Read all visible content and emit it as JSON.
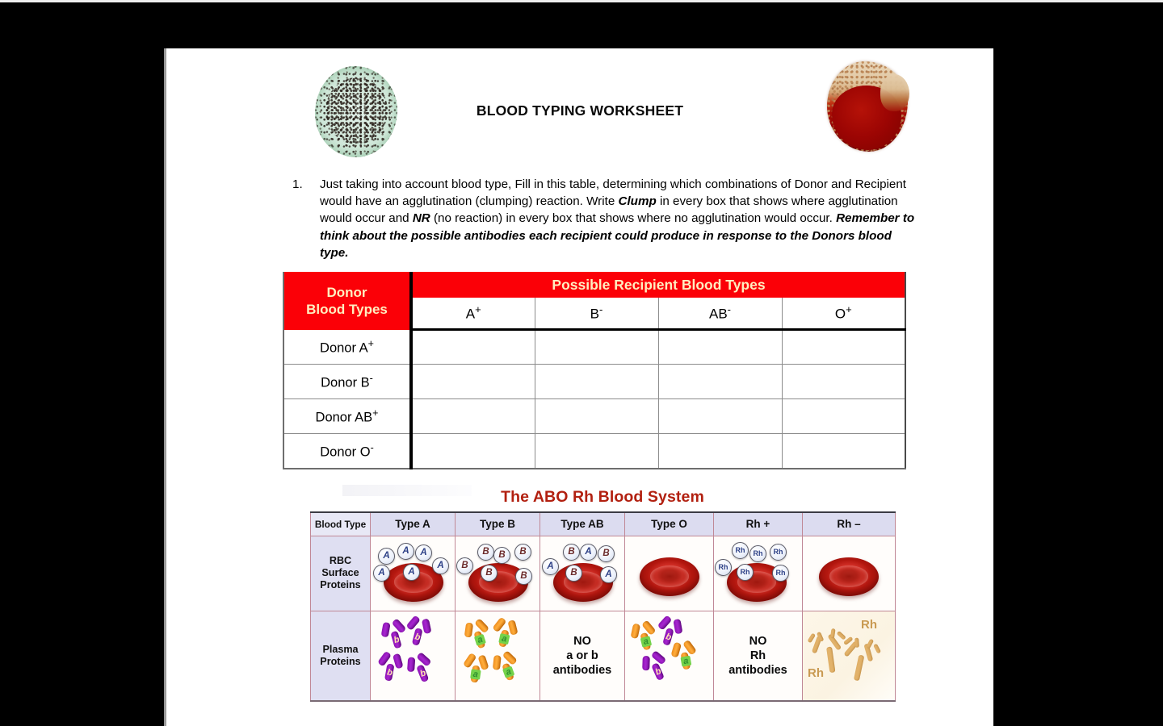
{
  "document": {
    "title": "BLOOD TYPING WORKSHEET",
    "left_image_name": "white-blood-cell-image",
    "right_image_name": "blood-sample-image"
  },
  "question": {
    "number": "1.",
    "part1": "Just taking into account blood type, Fill in this table, determining which combinations of Donor and Recipient would have an agglutination (clumping) reaction. Write ",
    "emph1": "Clump",
    "part2": " in every box that shows where agglutination would occur and ",
    "emph2": "NR",
    "part3": " (no reaction) in every box that shows where no agglutination would occur",
    "part4": ". ",
    "emph3": "Remember to think about the possible antibodies each recipient could produce in response to the Donors blood type."
  },
  "worksheet_table": {
    "donor_header_line1": "Donor",
    "donor_header_line2": "Blood Types",
    "recipient_header": "Possible Recipient Blood Types",
    "recipient_types": [
      {
        "letter": "A",
        "sign": "+"
      },
      {
        "letter": "B",
        "sign": "-"
      },
      {
        "letter": "AB",
        "sign": "-"
      },
      {
        "letter": "O",
        "sign": "+"
      }
    ],
    "donor_rows": [
      {
        "label": "Donor A",
        "sign": "+",
        "answers": [
          "",
          "",
          "",
          ""
        ]
      },
      {
        "label": "Donor B",
        "sign": "-",
        "answers": [
          "",
          "",
          "",
          ""
        ]
      },
      {
        "label": "Donor AB",
        "sign": "+",
        "answers": [
          "",
          "",
          "",
          ""
        ]
      },
      {
        "label": "Donor O",
        "sign": "-",
        "answers": [
          "",
          "",
          "",
          ""
        ]
      }
    ],
    "colors": {
      "header_bg": "#fb0007",
      "header_text": "#ffeec0",
      "grid": "#8c8c8c"
    }
  },
  "abo_figure": {
    "title": "The ABO Rh Blood System",
    "title_color": "#b22010",
    "corner_label": "Blood Type",
    "columns": [
      "Type A",
      "Type B",
      "Type AB",
      "Type O",
      "Rh +",
      "Rh –"
    ],
    "rows": [
      {
        "label": "RBC\nSurface\nProteins",
        "label_lines": [
          "RBC",
          "Surface",
          "Proteins"
        ],
        "cells": [
          {
            "kind": "rbc",
            "markers": [
              "A",
              "A",
              "A",
              "A",
              "A",
              "A"
            ]
          },
          {
            "kind": "rbc",
            "markers": [
              "B",
              "B",
              "B",
              "B",
              "B",
              "B"
            ]
          },
          {
            "kind": "rbc",
            "markers": [
              "B",
              "A",
              "B",
              "A",
              "B",
              "A"
            ]
          },
          {
            "kind": "rbc",
            "markers": []
          },
          {
            "kind": "rbc",
            "markers": [
              "Rh",
              "Rh",
              "Rh",
              "Rh",
              "Rh",
              "Rh"
            ]
          },
          {
            "kind": "rbc",
            "markers": []
          }
        ]
      },
      {
        "label_lines": [
          "Plasma",
          "Proteins"
        ],
        "cells": [
          {
            "kind": "antibody",
            "color": "purple",
            "letters": [
              "b",
              "b",
              "b",
              "b"
            ]
          },
          {
            "kind": "antibody",
            "color": "orange",
            "letters": [
              "a",
              "a",
              "a",
              "a"
            ]
          },
          {
            "kind": "text",
            "lines": [
              "NO",
              "a or b",
              "antibodies"
            ]
          },
          {
            "kind": "antibody-mixed",
            "letters": [
              "a",
              "b",
              "a",
              "b"
            ]
          },
          {
            "kind": "text",
            "lines": [
              "NO",
              "Rh",
              "antibodies"
            ]
          },
          {
            "kind": "rh-antibody",
            "labels": [
              "Rh",
              "Rh"
            ]
          }
        ]
      }
    ],
    "colors": {
      "header_bg": "#dcdcf0",
      "row_label_bg": "#dfdff2",
      "border": "#c08896"
    }
  }
}
